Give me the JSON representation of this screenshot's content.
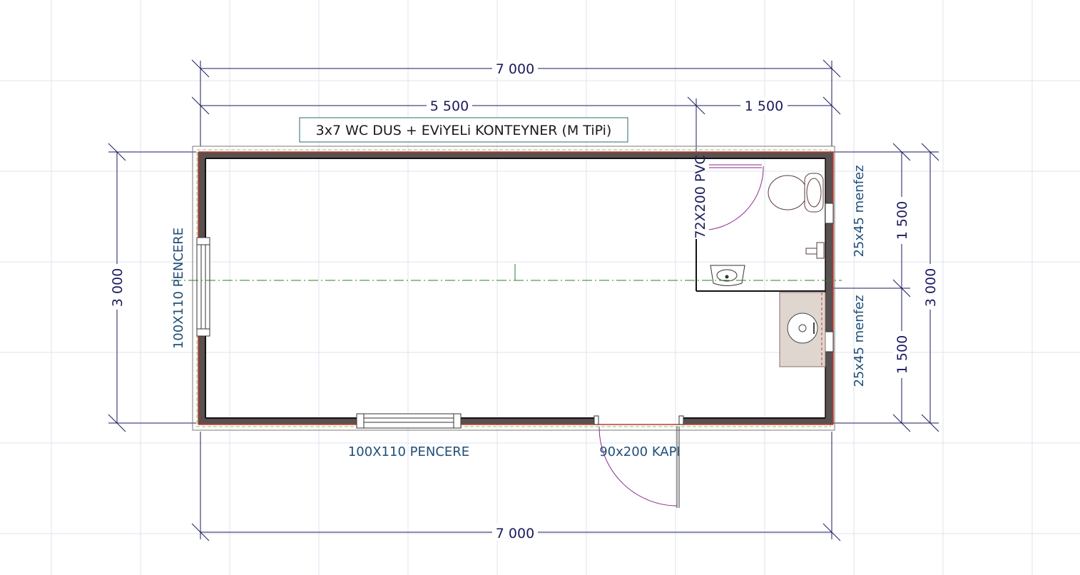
{
  "title": "3x7 WC DUS + EViYELi KONTEYNER (M TiPi)",
  "dimensions": {
    "overall_top": "7 000",
    "overall_bottom": "7 000",
    "segment_left": "5 500",
    "segment_right": "1 500",
    "height_left": "3 000",
    "height_right": "3 000",
    "right_upper": "1 500",
    "right_lower": "1 500"
  },
  "labels": {
    "window_left": "100X110 PENCERE",
    "window_bottom": "100X110 PENCERE",
    "door_main": "90x200 KAPI",
    "door_wc": "72X200 PVC",
    "vent_upper": "25x45 menfez",
    "vent_lower": "25x45 menfez"
  },
  "colors": {
    "grid": "#dfe3ec",
    "dimension": "#1a1a5e",
    "label": "#1f4e79",
    "wall_fill": "#5a5050",
    "wall_inner_line": "#c0392b",
    "axis": "#2e7d32",
    "door_arc": "#8b2a8b",
    "counter": "#e0d6d0"
  }
}
